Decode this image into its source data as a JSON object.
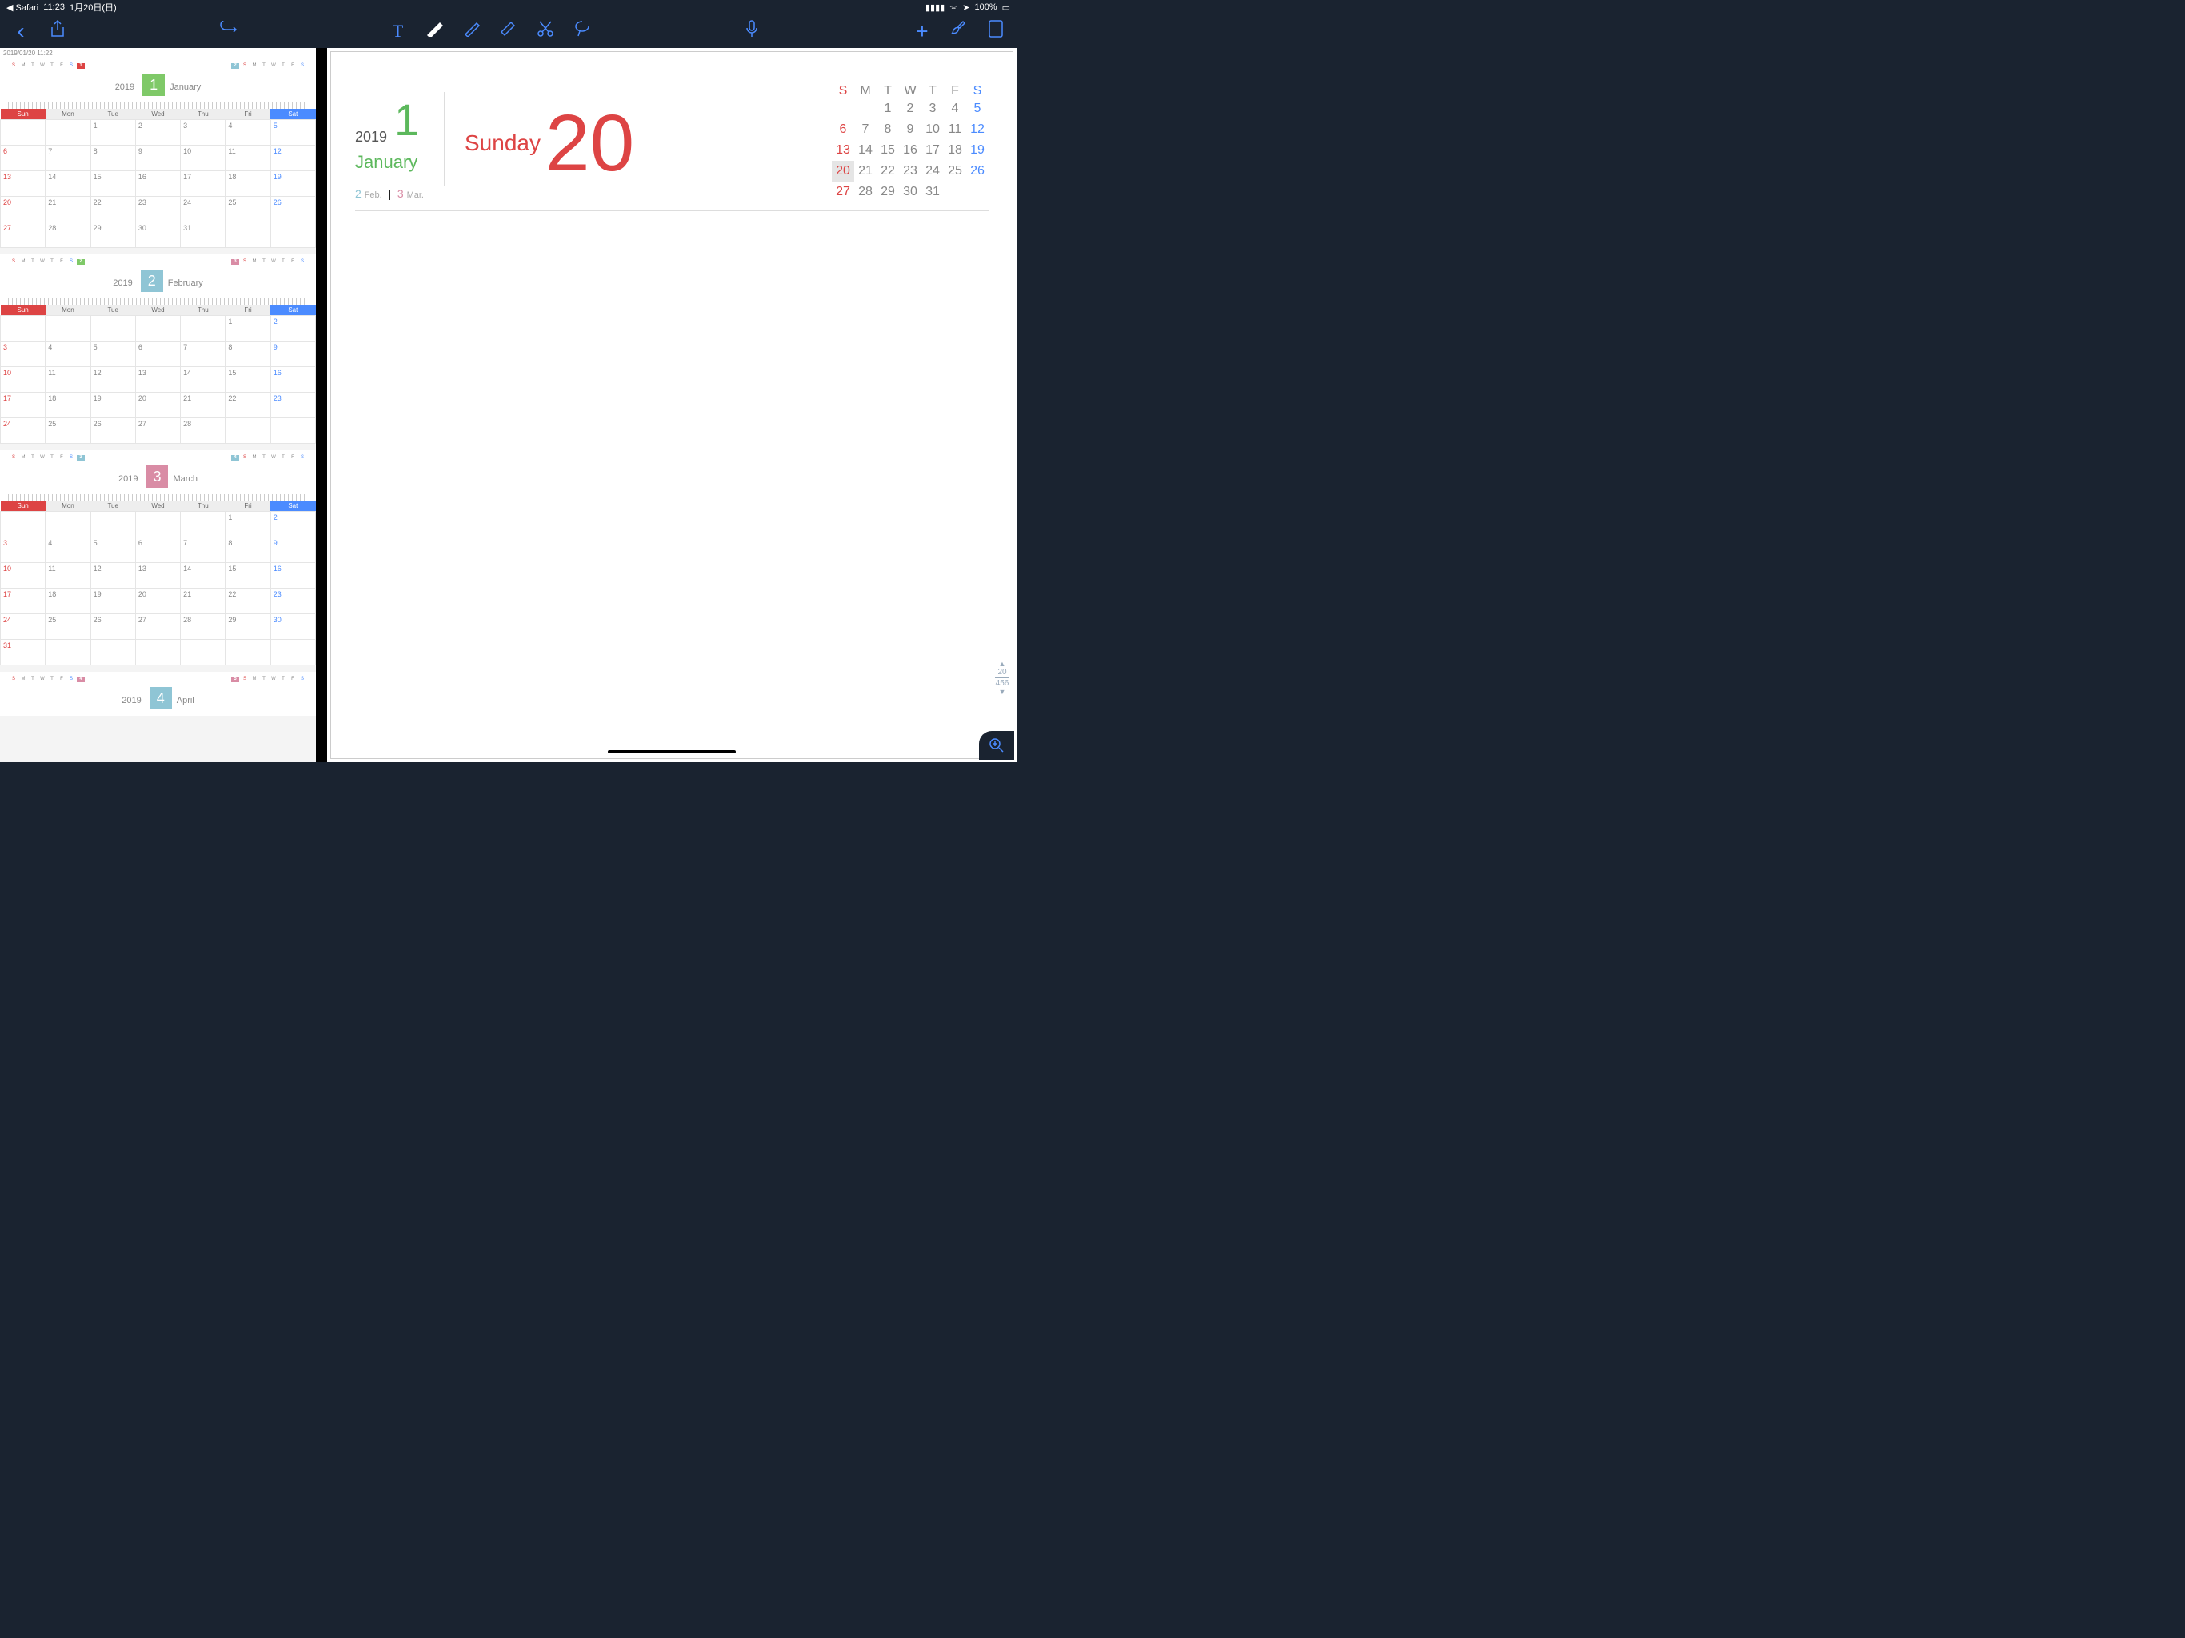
{
  "status": {
    "back": "◀ Safari",
    "time": "11:23",
    "date": "1月20日(日)",
    "batt": "100%"
  },
  "tb": {
    "back": "‹",
    "share": "⇪",
    "undo": "↶",
    "text": "T",
    "pen": "●",
    "hl": "◇",
    "erase": "◇",
    "cut": "✂",
    "lasso": "☟",
    "mic": "🎤",
    "add": "+",
    "wrench": "🔧",
    "pages": "▢"
  },
  "sidebar": {
    "ts": "2019/01/20 11:22",
    "months": [
      {
        "y": "2019",
        "n": "1",
        "name": "January",
        "cls": "c1",
        "prev_hd": "S M T W T F S",
        "next_hd": "S M T W T F S",
        "dow": [
          "Sun",
          "Mon",
          "Tue",
          "Wed",
          "Thu",
          "Fri",
          "Sat"
        ],
        "weeks": [
          [
            "",
            "",
            "1",
            "2",
            "3",
            "4",
            "5"
          ],
          [
            "6",
            "7",
            "8",
            "9",
            "10",
            "11",
            "12"
          ],
          [
            "13",
            "14",
            "15",
            "16",
            "17",
            "18",
            "19"
          ],
          [
            "20",
            "21",
            "22",
            "23",
            "24",
            "25",
            "26"
          ],
          [
            "27",
            "28",
            "29",
            "30",
            "31",
            "",
            ""
          ]
        ]
      },
      {
        "y": "2019",
        "n": "2",
        "name": "February",
        "cls": "c2",
        "dow": [
          "Sun",
          "Mon",
          "Tue",
          "Wed",
          "Thu",
          "Fri",
          "Sat"
        ],
        "weeks": [
          [
            "",
            "",
            "",
            "",
            "",
            "1",
            "2"
          ],
          [
            "3",
            "4",
            "5",
            "6",
            "7",
            "8",
            "9"
          ],
          [
            "10",
            "11",
            "12",
            "13",
            "14",
            "15",
            "16"
          ],
          [
            "17",
            "18",
            "19",
            "20",
            "21",
            "22",
            "23"
          ],
          [
            "24",
            "25",
            "26",
            "27",
            "28",
            "",
            ""
          ]
        ]
      },
      {
        "y": "2019",
        "n": "3",
        "name": "March",
        "cls": "c3",
        "dow": [
          "Sun",
          "Mon",
          "Tue",
          "Wed",
          "Thu",
          "Fri",
          "Sat"
        ],
        "weeks": [
          [
            "",
            "",
            "",
            "",
            "",
            "1",
            "2"
          ],
          [
            "3",
            "4",
            "5",
            "6",
            "7",
            "8",
            "9"
          ],
          [
            "10",
            "11",
            "12",
            "13",
            "14",
            "15",
            "16"
          ],
          [
            "17",
            "18",
            "19",
            "20",
            "21",
            "22",
            "23"
          ],
          [
            "24",
            "25",
            "26",
            "27",
            "28",
            "29",
            "30"
          ],
          [
            "31",
            "",
            "",
            "",
            "",
            "",
            ""
          ]
        ]
      },
      {
        "y": "2019",
        "n": "4",
        "name": "April",
        "cls": "c4",
        "dow": [],
        "weeks": []
      }
    ]
  },
  "main": {
    "year": "2019",
    "monthNum": "1",
    "monthName": "January",
    "next": [
      {
        "n": "2",
        "l": "Feb."
      },
      {
        "n": "3",
        "l": "Mar."
      }
    ],
    "dow": "Sunday",
    "day": "20",
    "hd": [
      "S",
      "M",
      "T",
      "W",
      "T",
      "F",
      "S"
    ],
    "weeks": [
      [
        "",
        "",
        "1",
        "2",
        "3",
        "4",
        "5"
      ],
      [
        "6",
        "7",
        "8",
        "9",
        "10",
        "11",
        "12"
      ],
      [
        "13",
        "14",
        "15",
        "16",
        "17",
        "18",
        "19"
      ],
      [
        "20",
        "21",
        "22",
        "23",
        "24",
        "25",
        "26"
      ],
      [
        "27",
        "28",
        "29",
        "30",
        "31",
        "",
        ""
      ]
    ],
    "pager": {
      "cur": "20",
      "tot": "456"
    }
  }
}
